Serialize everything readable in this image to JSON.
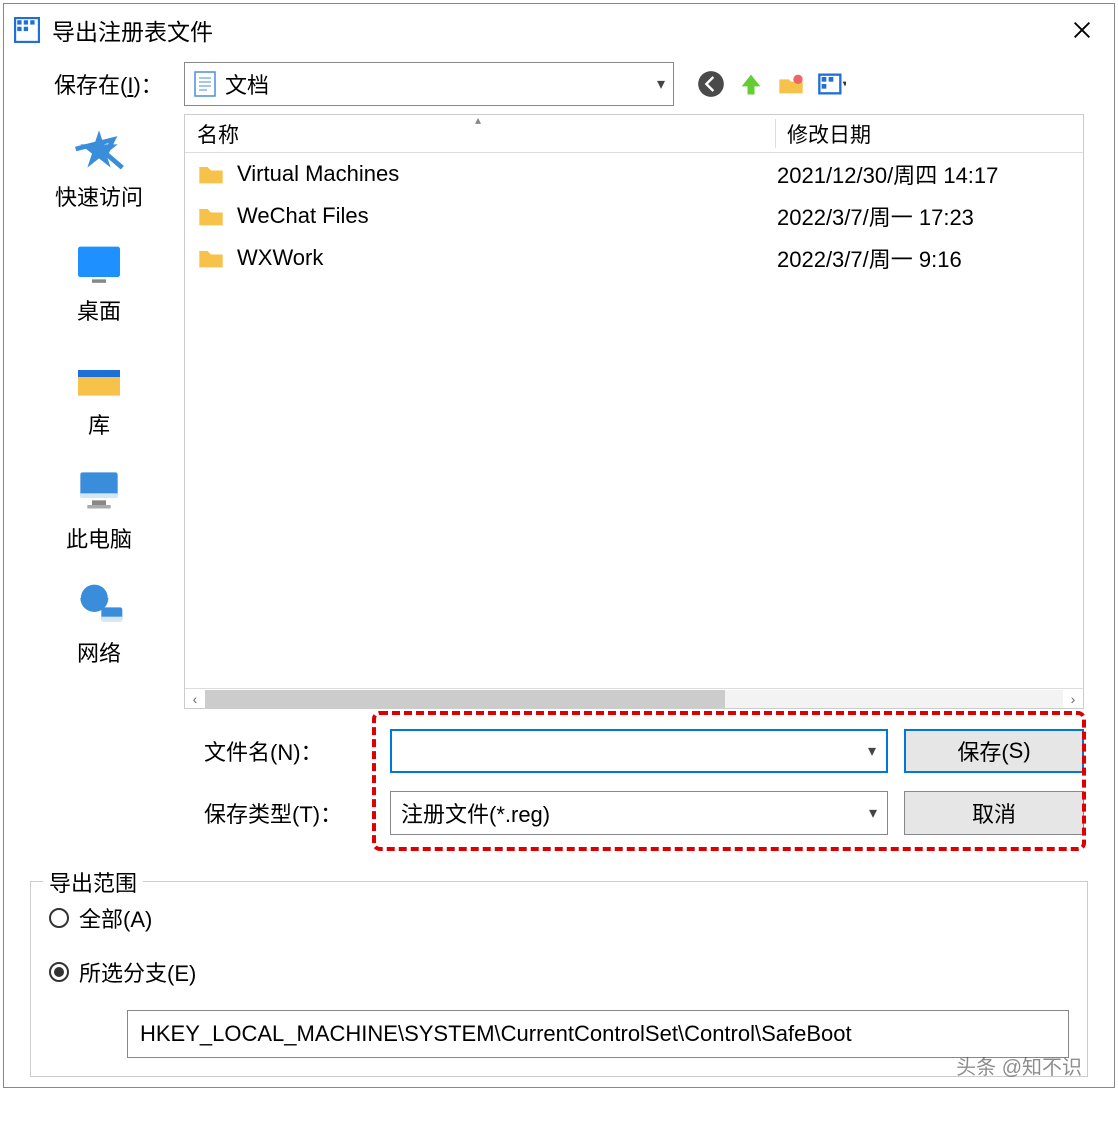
{
  "titlebar": {
    "title": "导出注册表文件"
  },
  "location": {
    "label_prefix": "保存在(",
    "label_hotkey": "I",
    "label_suffix": ")：",
    "value": "文档"
  },
  "nav_icons": [
    "back",
    "up",
    "new-folder",
    "views"
  ],
  "sidebar": [
    {
      "icon": "quickaccess",
      "label": "快速访问"
    },
    {
      "icon": "desktop",
      "label": "桌面"
    },
    {
      "icon": "libraries",
      "label": "库"
    },
    {
      "icon": "thispc",
      "label": "此电脑"
    },
    {
      "icon": "network",
      "label": "网络"
    }
  ],
  "columns": {
    "name": "名称",
    "date": "修改日期"
  },
  "files": [
    {
      "name": "Virtual Machines",
      "date": "2021/12/30/周四 14:17"
    },
    {
      "name": "WeChat Files",
      "date": "2022/3/7/周一 17:23"
    },
    {
      "name": "WXWork",
      "date": "2022/3/7/周一 9:16"
    }
  ],
  "filename": {
    "label_prefix": "文件名(",
    "label_hotkey": "N",
    "label_suffix": ")：",
    "value": ""
  },
  "filetype": {
    "label_prefix": "保存类型(",
    "label_hotkey": "T",
    "label_suffix": ")：",
    "value": "注册文件(*.reg)"
  },
  "buttons": {
    "save_prefix": "保存(",
    "save_hotkey": "S",
    "save_suffix": ")",
    "cancel": "取消"
  },
  "export_range": {
    "legend": "导出范围",
    "all_prefix": "全部(",
    "all_hotkey": "A",
    "all_suffix": ")",
    "selected_prefix": "所选分支(",
    "selected_hotkey": "E",
    "selected_suffix": ")",
    "branch": "HKEY_LOCAL_MACHINE\\SYSTEM\\CurrentControlSet\\Control\\SafeBoot"
  },
  "watermark": "头条 @知不识"
}
